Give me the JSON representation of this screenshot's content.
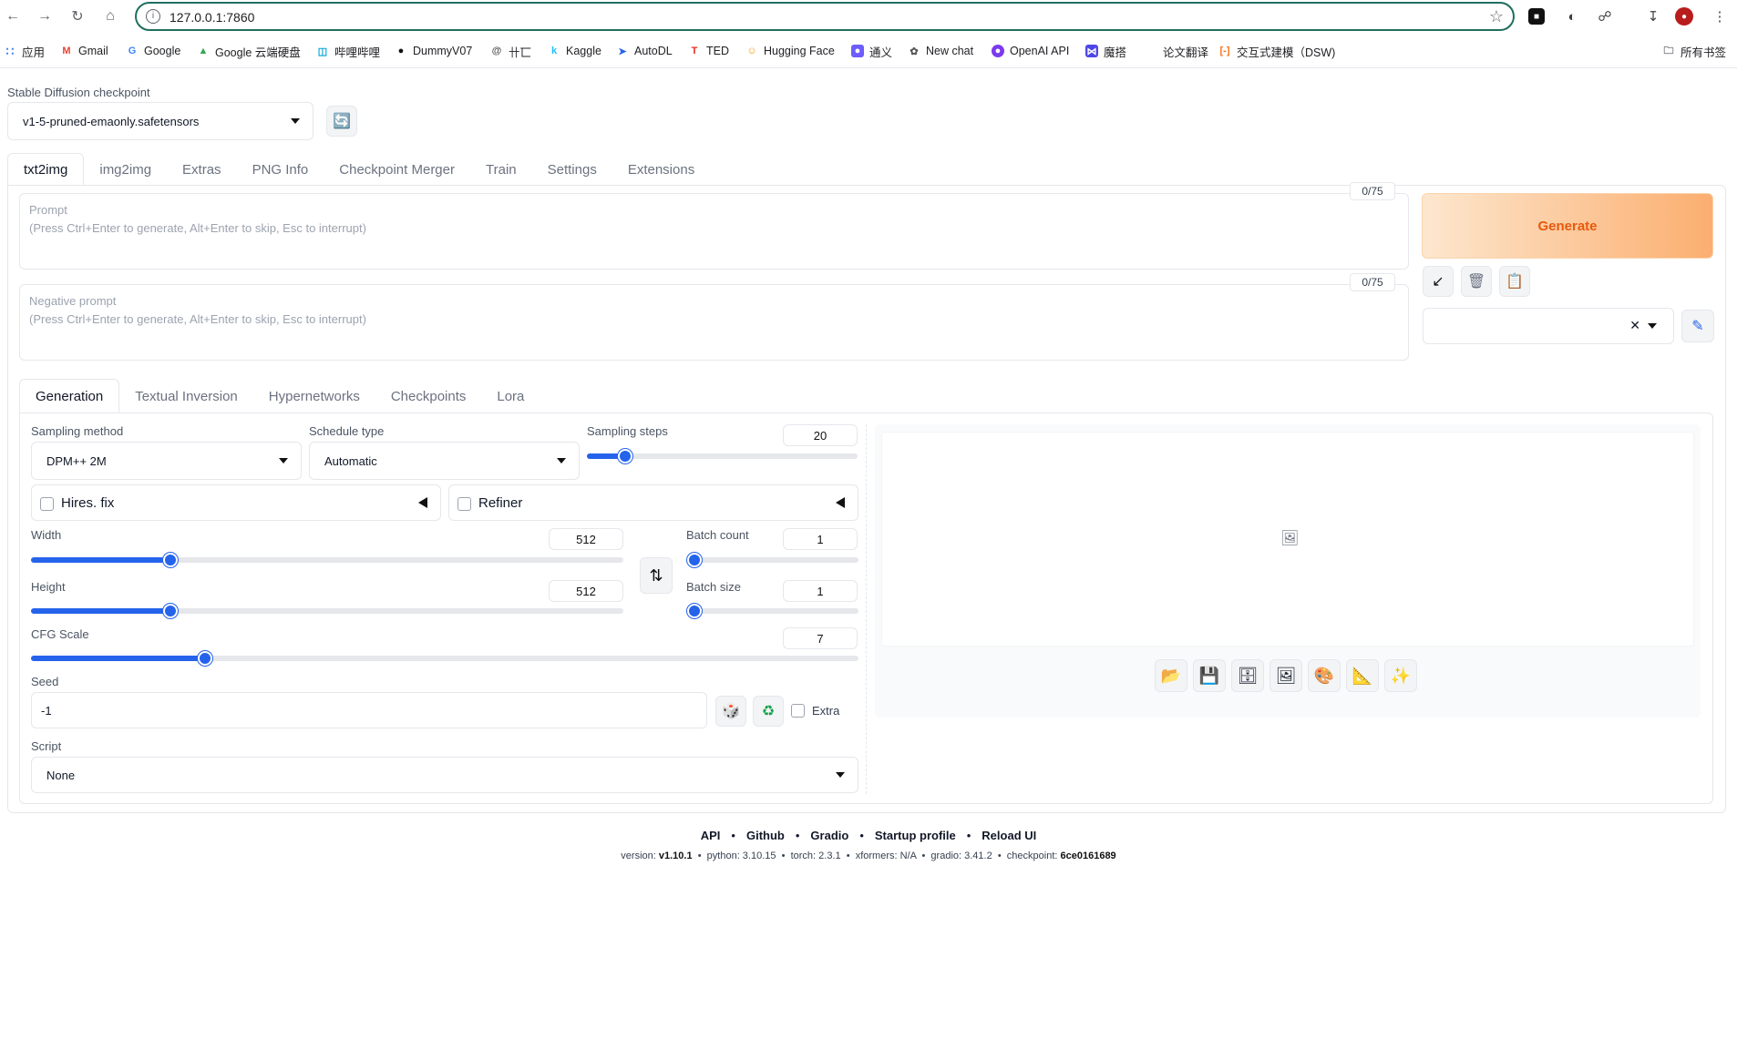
{
  "browser": {
    "url": "127.0.0.1:7860",
    "bookmarks": [
      "应用",
      "Gmail",
      "Google",
      "Google 云端硬盘",
      "哔哩哔哩",
      "DummyV07",
      "卄匸",
      "Kaggle",
      "AutoDL",
      "TED",
      "Hugging Face",
      "通义",
      "New chat",
      "OpenAI API",
      "魔搭",
      "论文翻译",
      "交互式建模（DSW)"
    ],
    "all_bookmarks": "所有书签"
  },
  "checkpoint": {
    "label": "Stable Diffusion checkpoint",
    "value": "v1-5-pruned-emaonly.safetensors"
  },
  "main_tabs": [
    "txt2img",
    "img2img",
    "Extras",
    "PNG Info",
    "Checkpoint Merger",
    "Train",
    "Settings",
    "Extensions"
  ],
  "prompt": {
    "label": "Prompt",
    "placeholder": "(Press Ctrl+Enter to generate, Alt+Enter to skip, Esc to interrupt)",
    "counter": "0/75"
  },
  "negative_prompt": {
    "label": "Negative prompt",
    "placeholder": "(Press Ctrl+Enter to generate, Alt+Enter to skip, Esc to interrupt)",
    "counter": "0/75"
  },
  "generate_label": "Generate",
  "sub_tabs": [
    "Generation",
    "Textual Inversion",
    "Hypernetworks",
    "Checkpoints",
    "Lora"
  ],
  "params": {
    "sampling_method_label": "Sampling method",
    "sampling_method": "DPM++ 2M",
    "schedule_type_label": "Schedule type",
    "schedule_type": "Automatic",
    "sampling_steps_label": "Sampling steps",
    "sampling_steps": "20",
    "sampling_steps_fraction": 0.14,
    "hires_label": "Hires. fix",
    "refiner_label": "Refiner",
    "width_label": "Width",
    "width": "512",
    "width_fraction": 0.235,
    "height_label": "Height",
    "height": "512",
    "height_fraction": 0.235,
    "batch_count_label": "Batch count",
    "batch_count": "1",
    "batch_count_fraction": 0.0,
    "batch_size_label": "Batch size",
    "batch_size": "1",
    "batch_size_fraction": 0.0,
    "cfg_label": "CFG Scale",
    "cfg": "7",
    "cfg_fraction": 0.21,
    "seed_label": "Seed",
    "seed": "-1",
    "extra_label": "Extra",
    "script_label": "Script",
    "script": "None"
  },
  "footer": {
    "links": [
      "API",
      "Github",
      "Gradio",
      "Startup profile",
      "Reload UI"
    ],
    "version_label": "version:",
    "version": "v1.10.1",
    "python": "python: 3.10.15",
    "torch": "torch: 2.3.1",
    "xformers": "xformers: N/A",
    "gradio": "gradio: 3.41.2",
    "checkpoint_label": "checkpoint:",
    "checkpoint": "6ce0161689"
  }
}
